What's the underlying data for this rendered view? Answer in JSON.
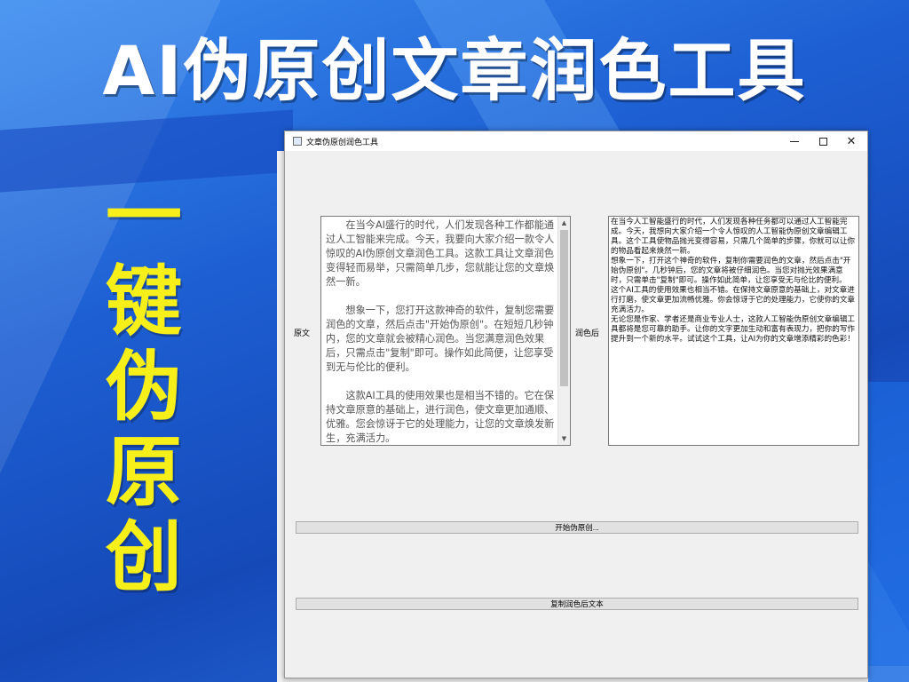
{
  "banner": {
    "title": "AI伪原创文章润色工具",
    "slogan": [
      "一",
      "键",
      "伪",
      "原",
      "创"
    ]
  },
  "colors": {
    "background": "#1f5fd0",
    "title": "#ffffff",
    "slogan": "#f6ef1a",
    "window_bg": "#f0f0f0"
  },
  "window": {
    "title": "文章伪原创润色工具",
    "icons": {
      "app": "app-window-icon",
      "minimize": "minimize-icon",
      "maximize": "maximize-icon",
      "close": "close-icon"
    },
    "close_glyph": "✕",
    "labels": {
      "original": "原文",
      "polished": "润色后"
    },
    "original_text": "　　在当今AI盛行的时代，人们发现各种工作都能通过人工智能来完成。今天，我要向大家介绍一款令人惊叹的AI伪原创文章润色工具。这款工具让文章润色变得轻而易举，只需简单几步，您就能让您的文章焕然一新。\n\n　　想象一下，您打开这款神奇的软件，复制您需要润色的文章，然后点击\"开始伪原创\"。在短短几秒钟内，您的文章就会被精心润色。当您满意润色效果后，只需点击\"复制\"即可。操作如此简便，让您享受到无与伦比的便利。\n\n　　这款AI工具的使用效果也是相当不错的。它在保持文章原意的基础上，进行润色，使文章更加通顺、优雅。您会惊讶于它的处理能力，让您的文章焕发新生，充满活力。\n\n　　无论您是写手、学者还是商业人士，这款AI伪原",
    "scroll_up": "▲",
    "scroll_down": "▼",
    "polished_text": "在当今人工智能盛行的时代，人们发现各种任务都可以通过人工智能完成。今天，我想向大家介绍一个令人惊叹的人工智能伪原创文章编辑工具。这个工具使物品抛光变得容易，只需几个简单的步骤，你就可以让你的物品看起来焕然一新。\n想象一下，打开这个神奇的软件，复制你需要润色的文章，然后点击\"开始伪原创\"。几秒钟后，您的文章将被仔细润色。当您对抛光效果满意时，只需单击\"复制\"即可。操作如此简单，让您享受无与伦比的便利。\n这个AI工具的使用效果也相当不错。在保持文章原意的基础上，对文章进行打磨，使文章更加流畅优雅。你会惊讶于它的处理能力，它使你的文章充满活力。\n无论您是作家、学者还是商业专业人士，这款人工智能伪原创文章编辑工具都将是您可靠的助手。让你的文字更加生动和富有表现力，把你的写作提升到一个新的水平。试试这个工具，让AI为你的文章增添精彩的色彩！",
    "buttons": {
      "start": "开始伪原创...",
      "copy": "复制润色后文本"
    }
  }
}
